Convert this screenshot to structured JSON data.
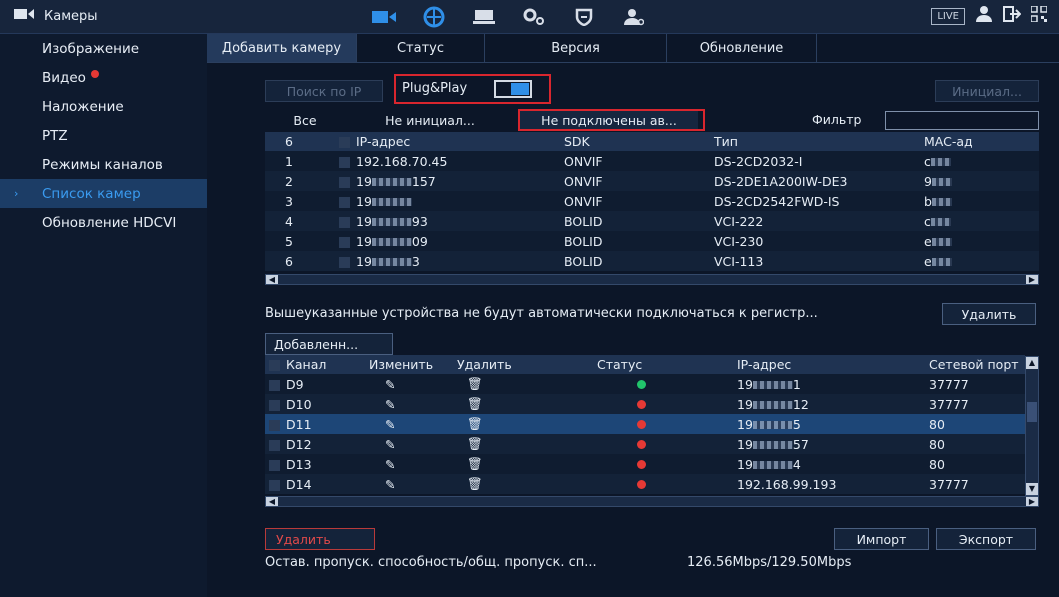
{
  "topbar": {
    "title": "Камеры",
    "icons": [
      "camera-icon",
      "network-icon",
      "storage-icon",
      "settings-icon",
      "shield-icon",
      "account-icon"
    ],
    "live_label": "LIVE",
    "right_icons": [
      "user-icon",
      "logout-icon",
      "qr-icon"
    ]
  },
  "sidebar": {
    "items": [
      {
        "label": "Изображение"
      },
      {
        "label": "Видео",
        "has_alert": true
      },
      {
        "label": "Наложение"
      },
      {
        "label": "PTZ"
      },
      {
        "label": "Режимы каналов"
      },
      {
        "label": "Список камер",
        "active": true
      },
      {
        "label": "Обновление HDCVI"
      }
    ]
  },
  "tabs": [
    "Добавить камеру",
    "Статус",
    "Версия",
    "Обновление"
  ],
  "toolbar": {
    "ip_search_label": "Поиск по IP",
    "plug_play_label": "Plug&Play",
    "init_label": "Инициал..."
  },
  "filter": {
    "tabs": [
      "Все",
      "Не инициал...",
      "Не подключены ав..."
    ],
    "filter_label": "Фильтр"
  },
  "discovered": {
    "header": [
      "6",
      "IP-адрес",
      "SDK",
      "Тип",
      "MAC-ад"
    ],
    "rows": [
      {
        "n": "1",
        "ip_prefix": "192.168.70.45",
        "sdk": "ONVIF",
        "type": "DS-2CD2032-I",
        "mac": "c"
      },
      {
        "n": "2",
        "ip_prefix": "19",
        "ip_suffix": "157",
        "sdk": "ONVIF",
        "type": "DS-2DE1A200IW-DE3",
        "mac": "9"
      },
      {
        "n": "3",
        "ip_prefix": "19",
        "ip_suffix": "",
        "sdk": "ONVIF",
        "type": "DS-2CD2542FWD-IS",
        "mac": "b"
      },
      {
        "n": "4",
        "ip_prefix": "19",
        "ip_suffix": "93",
        "sdk": "BOLID",
        "type": "VCI-222",
        "mac": "c"
      },
      {
        "n": "5",
        "ip_prefix": "19",
        "ip_suffix": "09",
        "sdk": "BOLID",
        "type": "VCI-230",
        "mac": "e"
      },
      {
        "n": "6",
        "ip_prefix": "19",
        "ip_suffix": "3",
        "sdk": "BOLID",
        "type": "VCI-113",
        "mac": "e"
      }
    ]
  },
  "notice": "Вышеуказанные устройства не будут автоматически подключаться к регистр...",
  "delete_label": "Удалить",
  "added_tab_label": "Добавленн...",
  "added": {
    "header": [
      "Канал",
      "Изменить",
      "Удалить",
      "Статус",
      "IP-адрес",
      "Сетевой порт"
    ],
    "rows": [
      {
        "ch": "D9",
        "status": "green",
        "ip_prefix": "19",
        "ip_suffix": "1",
        "port": "37777"
      },
      {
        "ch": "D10",
        "status": "red",
        "ip_prefix": "19",
        "ip_suffix": "12",
        "port": "37777"
      },
      {
        "ch": "D11",
        "status": "red",
        "ip_prefix": "19",
        "ip_suffix": "5",
        "port": "80",
        "selected": true
      },
      {
        "ch": "D12",
        "status": "red",
        "ip_prefix": "19",
        "ip_suffix": "57",
        "port": "80"
      },
      {
        "ch": "D13",
        "status": "red",
        "ip_prefix": "19",
        "ip_suffix": "4",
        "port": "80"
      },
      {
        "ch": "D14",
        "status": "red",
        "ip_prefix": "192.168.99.193",
        "ip_suffix": "",
        "port": "37777"
      }
    ]
  },
  "footer": {
    "delete_label": "Удалить",
    "import_label": "Импорт",
    "export_label": "Экспорт",
    "bandwidth_label": "Остав. пропуск. способность/общ. пропуск. сп...",
    "bandwidth_value": "126.56Mbps/129.50Mbps"
  },
  "colors": {
    "accent": "#2f8fe8",
    "highlight": "#d9262e",
    "status_green": "#21c46b",
    "status_red": "#e53935"
  }
}
